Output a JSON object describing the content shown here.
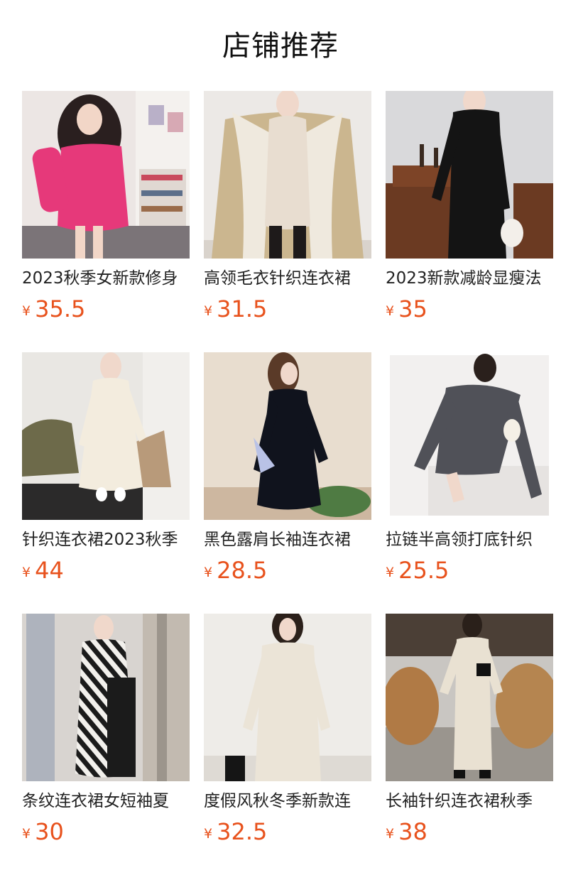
{
  "page": {
    "title": "店铺推荐"
  },
  "currency_symbol": "¥",
  "products": [
    {
      "title": "2023秋季女新款修身",
      "price": "35.5",
      "image": "pink-knit-dress-photo"
    },
    {
      "title": "高领毛衣针织连衣裙",
      "price": "31.5",
      "image": "cream-knit-dress-fur-coat-photo"
    },
    {
      "title": "2023新款减龄显瘦法",
      "price": "35",
      "image": "black-long-knit-dress-photo"
    },
    {
      "title": "针织连衣裙2023秋季",
      "price": "44",
      "image": "ivory-long-knit-dress-photo"
    },
    {
      "title": "黑色露肩长袖连衣裙",
      "price": "28.5",
      "image": "black-cold-shoulder-dress-photo"
    },
    {
      "title": "拉链半高领打底针织",
      "price": "25.5",
      "image": "grey-zip-knit-dress-photo"
    },
    {
      "title": "条纹连衣裙女短袖夏",
      "price": "30",
      "image": "striped-short-sleeve-dress-photo"
    },
    {
      "title": "度假风秋冬季新款连",
      "price": "32.5",
      "image": "cream-v-neck-knit-dress-photo"
    },
    {
      "title": "长袖针织连衣裙秋季",
      "price": "38",
      "image": "beige-long-knit-dress-photo"
    }
  ]
}
